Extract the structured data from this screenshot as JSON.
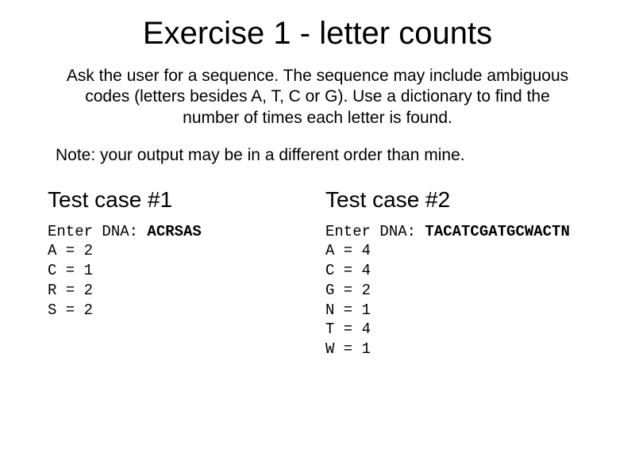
{
  "title": "Exercise 1 - letter counts",
  "description": "Ask the user for a sequence.  The sequence may include ambiguous codes (letters besides A, T, C or G).  Use a dictionary to find the number of times each letter is found.",
  "note": "Note:  your output may be in a different order than mine.",
  "cases": [
    {
      "title": "Test case #1",
      "prompt": "Enter DNA: ",
      "input": "ACRSAS",
      "results": [
        {
          "letter": "A",
          "count": 2
        },
        {
          "letter": "C",
          "count": 1
        },
        {
          "letter": "R",
          "count": 2
        },
        {
          "letter": "S",
          "count": 2
        }
      ]
    },
    {
      "title": "Test case #2",
      "prompt": "Enter DNA: ",
      "input": "TACATCGATGCWACTN",
      "results": [
        {
          "letter": "A",
          "count": 4
        },
        {
          "letter": "C",
          "count": 4
        },
        {
          "letter": "G",
          "count": 2
        },
        {
          "letter": "N",
          "count": 1
        },
        {
          "letter": "T",
          "count": 4
        },
        {
          "letter": "W",
          "count": 1
        }
      ]
    }
  ]
}
